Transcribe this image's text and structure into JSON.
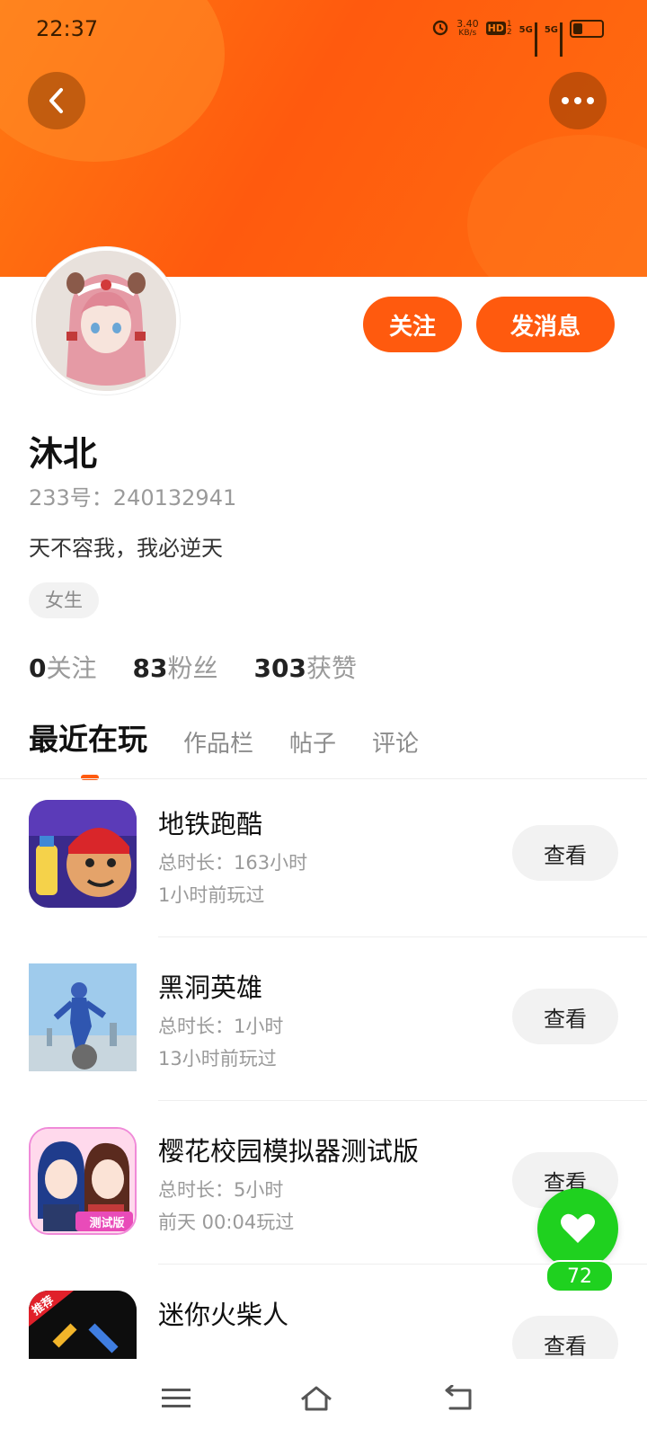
{
  "status_bar": {
    "time": "22:37",
    "net_speed_value": "3.40",
    "net_speed_unit": "KB/s",
    "hd": "HD",
    "hd_sim": "1",
    "hd_sim2": "2",
    "signal1": "5G",
    "signal2": "5G"
  },
  "header": {
    "back_icon": "back-arrow-icon",
    "more_icon": "more-dots-icon",
    "accent_color": "#ff5a0e"
  },
  "profile": {
    "name": "沐北",
    "uid": "233号：240132941",
    "bio": "天不容我，我必逆天",
    "gender": "女生",
    "follow_label": "关注",
    "message_label": "发消息"
  },
  "stats": [
    {
      "num": "0",
      "label": "关注"
    },
    {
      "num": "83",
      "label": "粉丝"
    },
    {
      "num": "303",
      "label": "获赞"
    }
  ],
  "tabs": [
    {
      "label": "最近在玩",
      "active": true
    },
    {
      "label": "作品栏",
      "active": false
    },
    {
      "label": "帖子",
      "active": false
    },
    {
      "label": "评论",
      "active": false
    }
  ],
  "games": [
    {
      "title": "地铁跑酷",
      "duration": "总时长：163小时",
      "last_played": "1小时前玩过",
      "button": "查看"
    },
    {
      "title": "黑洞英雄",
      "duration": "总时长：1小时",
      "last_played": "13小时前玩过",
      "button": "查看"
    },
    {
      "title": "樱花校园模拟器测试版",
      "duration": "总时长：5小时",
      "last_played": "前天 00:04玩过",
      "button": "查看",
      "badge": "测试版"
    },
    {
      "title": "迷你火柴人",
      "duration": "",
      "last_played": "",
      "button": "查看",
      "badge": "推荐"
    }
  ],
  "fab": {
    "icon": "heart-icon",
    "count": "72"
  },
  "navbar": {
    "menu_icon": "menu-icon",
    "home_icon": "home-icon",
    "back_icon": "back-icon"
  }
}
